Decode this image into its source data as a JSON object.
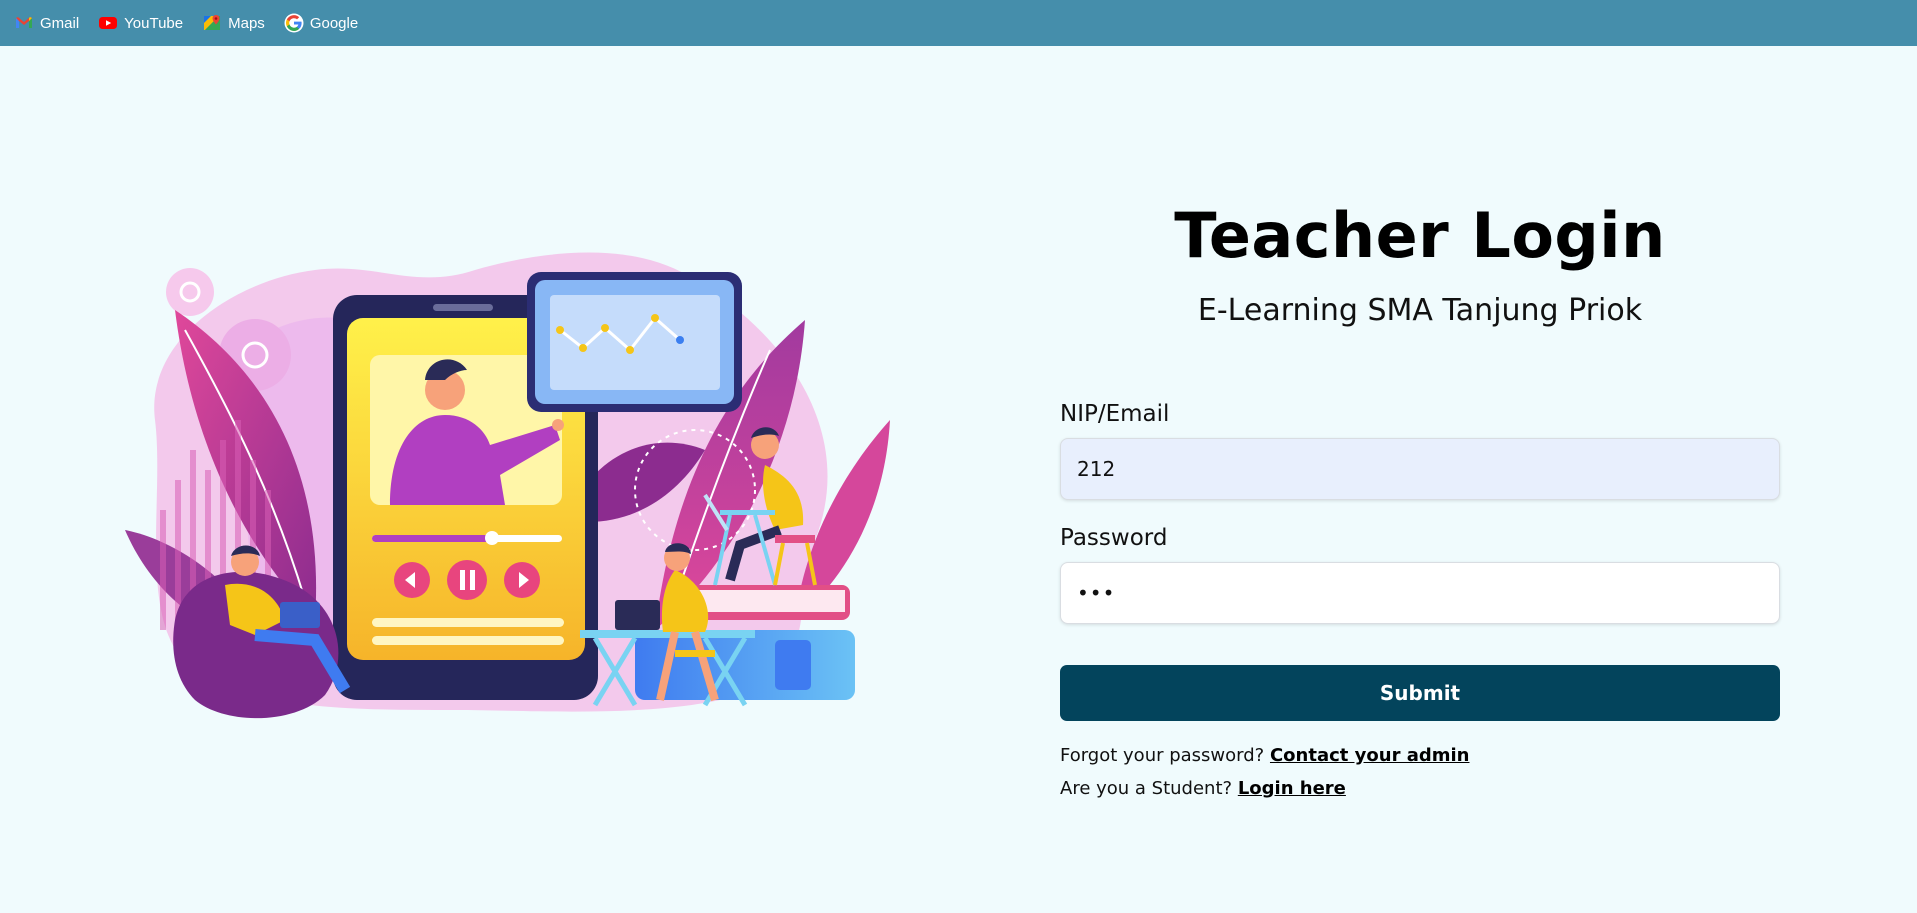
{
  "bookmarks": [
    {
      "label": "Gmail",
      "icon": "gmail-icon"
    },
    {
      "label": "YouTube",
      "icon": "youtube-icon"
    },
    {
      "label": "Maps",
      "icon": "maps-icon"
    },
    {
      "label": "Google",
      "icon": "google-icon"
    }
  ],
  "login": {
    "title": "Teacher Login",
    "subtitle": "E-Learning SMA Tanjung Priok",
    "email_label": "NIP/Email",
    "email_value": "212",
    "password_label": "Password",
    "password_value": "•••",
    "submit_label": "Submit",
    "forgot_text": "Forgot your password?",
    "forgot_link": "Contact your admin",
    "student_text": "Are you a Student?",
    "student_link": "Login here"
  },
  "colors": {
    "bookmark_bar": "#458eab",
    "page_background": "#f0fbfd",
    "submit_button": "#03445c",
    "email_field": "#e8effd"
  }
}
